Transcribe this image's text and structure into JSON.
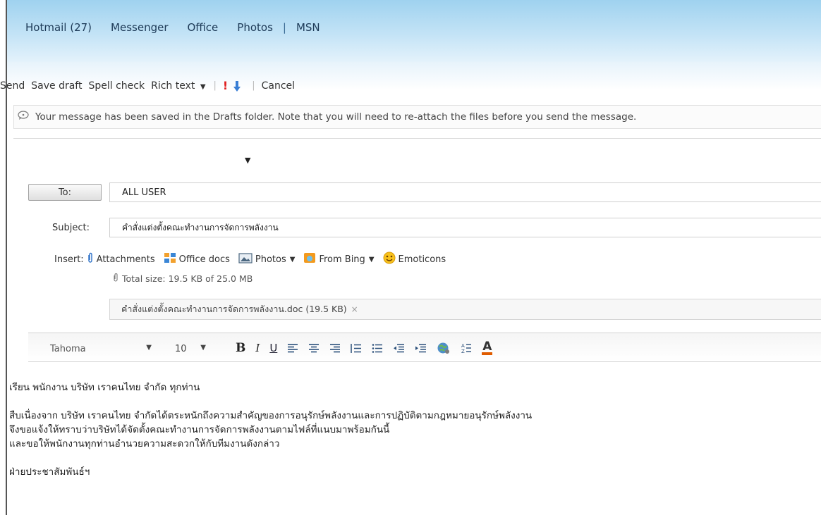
{
  "nav": {
    "items": [
      "Hotmail (27)",
      "Messenger",
      "Office",
      "Photos"
    ],
    "separator": "|",
    "msn": "MSN"
  },
  "toolbar": {
    "send": "Send",
    "save_draft": "Save draft",
    "spell_check": "Spell check",
    "rich_text": "Rich text",
    "rich_text_arrow": "▼",
    "separator": "|",
    "high_importance": "!",
    "cancel": "Cancel",
    "colors": {
      "high_importance": "#e02020",
      "low_importance": "#3a7fd5"
    }
  },
  "notice": {
    "text": "Your message has been saved in the Drafts folder. Note that you will need to re-attach the files before you send the message."
  },
  "compose": {
    "from_caret": "▼",
    "to_label": "To:",
    "to_value": "ALL USER",
    "subject_label": "Subject:",
    "subject_value": "คำสั่งแต่งตั้งคณะทำงานการจัดการพลังงาน",
    "insert_label": "Insert:",
    "insert_items": [
      {
        "label": "Attachments",
        "icon": "paperclip-icon"
      },
      {
        "label": "Office docs",
        "icon": "office-docs-icon"
      },
      {
        "label": "Photos",
        "icon": "photos-icon",
        "dropdown": "▼"
      },
      {
        "label": "From Bing",
        "icon": "bing-icon",
        "dropdown": "▼"
      },
      {
        "label": "Emoticons",
        "icon": "emoticon-icon"
      }
    ],
    "total_size": "Total size: 19.5 KB of 25.0 MB",
    "attachment": {
      "name": "คำสั่งแต่งตั้งคณะทำงานการจัดการพลังงาน.doc (19.5 KB)",
      "remove": "×"
    }
  },
  "format": {
    "font": "Tahoma",
    "size": "10",
    "dropdown_arrow": "▼",
    "bold": "B",
    "italic": "I",
    "underline": "U",
    "font_color_letter": "A",
    "font_color": "#e05c00",
    "icons": [
      "align-left-icon",
      "align-center-icon",
      "align-right-icon",
      "numbered-list-icon",
      "bullet-list-icon",
      "outdent-icon",
      "indent-icon",
      "hyperlink-icon",
      "highlight-icon",
      "font-color-icon"
    ]
  },
  "message": {
    "greeting": "เรียน พนักงาน บริษัท เราคนไทย จำกัด ทุกท่าน",
    "lines": [
      "สืบเนื่องจาก บริษัท เราคนไทย จำกัดได้ตระหนักถึงความสำคัญของการอนุรักษ์พลังงานและการปฏิบัติตามกฎหมายอนุรักษ์พลังงาน",
      "จึงขอแจ้งให้ทราบว่าบริษัทได้จัดตั้งคณะทำงานการจัดการพลังงานตามไฟล์ที่แนบมาพร้อมกันนี้",
      "และขอให้พนักงานทุกท่านอำนวยความสะดวกให้กับทีมงานดังกล่าว"
    ],
    "signature": "ฝ่ายประชาสัมพันธ์ฯ"
  }
}
